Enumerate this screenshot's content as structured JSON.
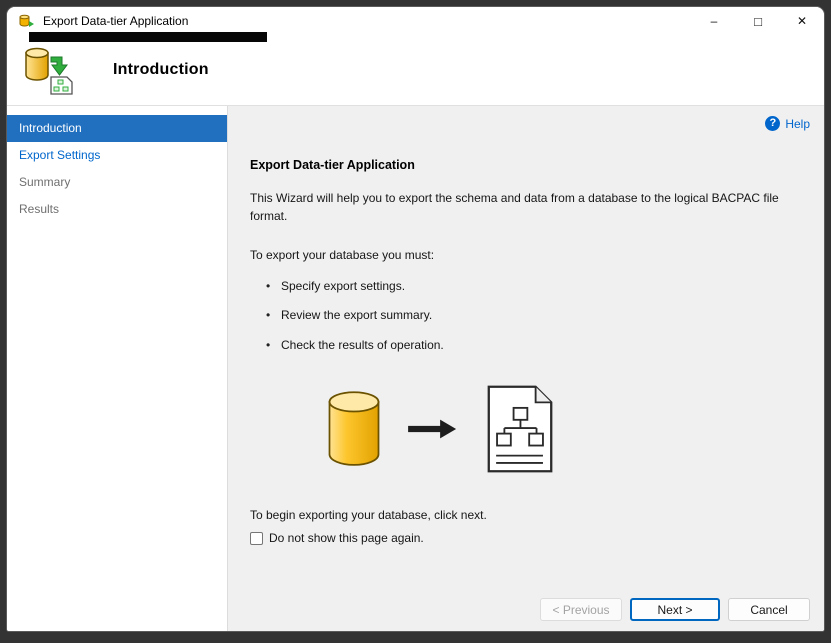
{
  "window": {
    "title": "Export Data-tier Application",
    "controls": {
      "minimize": "–",
      "maximize": "□",
      "close": "✕"
    }
  },
  "header": {
    "title": "Introduction"
  },
  "sidebar": {
    "items": [
      {
        "label": "Introduction",
        "state": "selected"
      },
      {
        "label": "Export Settings",
        "state": "link"
      },
      {
        "label": "Summary",
        "state": "disabled"
      },
      {
        "label": "Results",
        "state": "disabled"
      }
    ]
  },
  "content": {
    "help_label": "Help",
    "help_glyph": "?",
    "heading": "Export Data-tier Application",
    "intro": "This Wizard will help you to export the schema and data from a database to the logical BACPAC file format.",
    "requirements_label": "To export your database you must:",
    "bullets": [
      {
        "text": "Specify export settings."
      },
      {
        "text": "Review the export summary."
      },
      {
        "text": "Check the results of operation."
      }
    ],
    "begin_text": "To begin exporting your database, click next.",
    "checkbox_label": "Do not show this page again.",
    "checkbox_checked": false
  },
  "footer": {
    "previous_label": "< Previous",
    "next_label": "Next >",
    "cancel_label": "Cancel"
  },
  "colors": {
    "selected_nav_bg": "#2170c0",
    "link_blue": "#0066cc",
    "focused_button_border": "#0067c0",
    "content_bg": "#f0f0f0",
    "frame_bg": "#333333"
  }
}
